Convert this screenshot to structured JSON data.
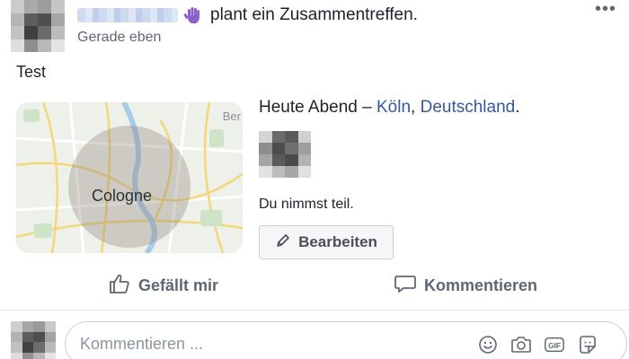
{
  "post": {
    "author_action": "plant ein Zusammentreffen.",
    "timestamp": "Gerade eben",
    "text": "Test",
    "more_label": "•••"
  },
  "map": {
    "city_label": "Cologne",
    "corner_label": "Ber"
  },
  "event": {
    "time": "Heute Abend",
    "separator": " – ",
    "city": "Köln",
    "comma": ", ",
    "country": "Deutschland",
    "period": ".",
    "status": "Du nimmst teil.",
    "edit_label": "Bearbeiten"
  },
  "actions": {
    "like_label": "Gefällt mir",
    "comment_label": "Kommentieren"
  },
  "comment": {
    "placeholder": "Kommentieren ...",
    "tools": [
      "emoji-icon",
      "camera-icon",
      "gif-icon",
      "sticker-icon"
    ]
  },
  "colors": {
    "link": "#365899",
    "text": "#1d2129",
    "muted": "#616770",
    "wave_icon": "#8b5fc7"
  }
}
